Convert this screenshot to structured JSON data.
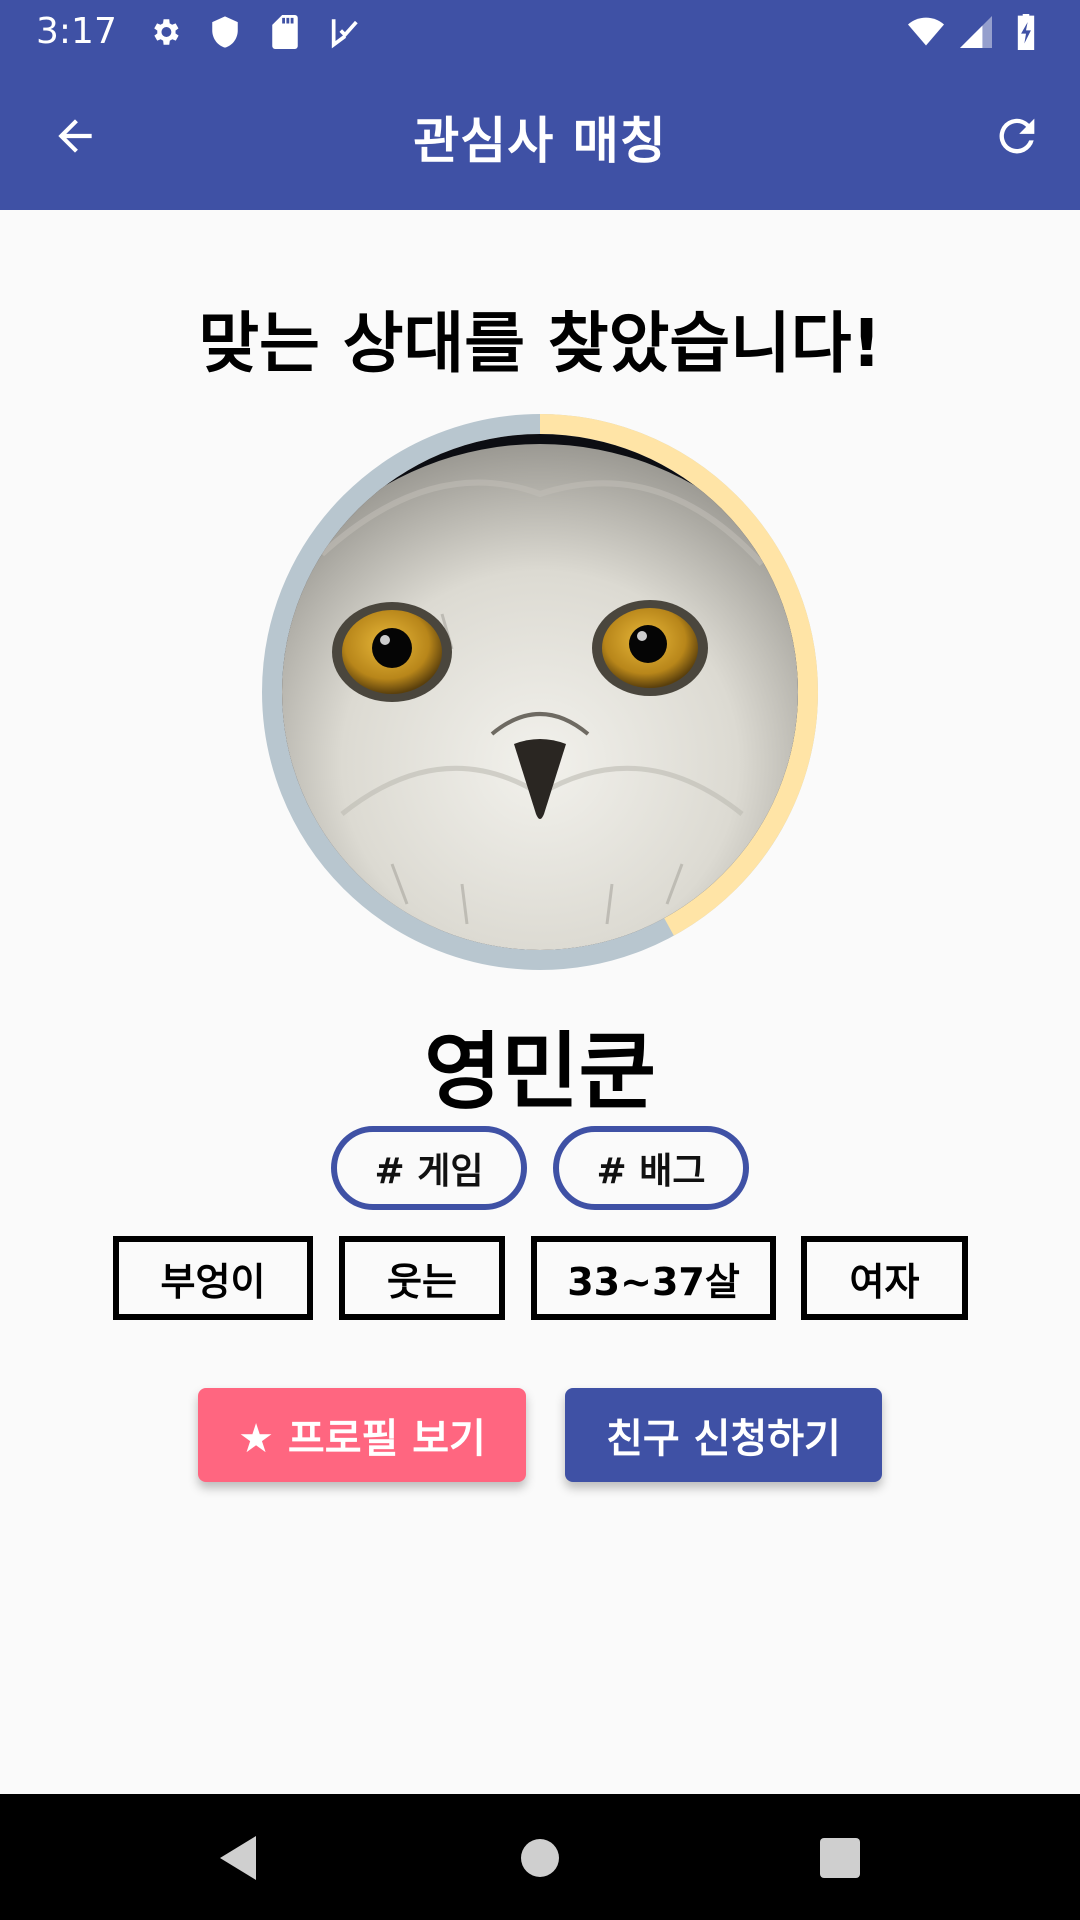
{
  "status_bar": {
    "time": "3:17",
    "icons_left": [
      "gear-icon",
      "shield-icon",
      "sd-card-icon",
      "inbox-check-icon"
    ],
    "icons_right": [
      "wifi-icon",
      "signal-icon",
      "battery-charging-icon"
    ]
  },
  "app_bar": {
    "title": "관심사 매칭",
    "back_icon": "arrow-back-icon",
    "refresh_icon": "refresh-icon",
    "color": "#3f51a5"
  },
  "main": {
    "heading": "맞는 상대를 찾았습니다!",
    "match_progress": 0.42,
    "ring_colors": {
      "progress": "#ffe4a6",
      "track": "#b8c6cf"
    },
    "name": "영민쿤",
    "tags": [
      "# 게임",
      "# 배그"
    ],
    "attributes": [
      "부엉이",
      "웃는",
      "33~37살",
      "여자"
    ],
    "buttons": {
      "profile_label": "★ 프로필 보기",
      "friend_label": "친구 신청하기"
    },
    "button_colors": {
      "profile": "#ff6680",
      "friend": "#3f51a5"
    }
  },
  "nav_bar": {
    "icons": [
      "nav-back-icon",
      "nav-home-icon",
      "nav-recents-icon"
    ]
  }
}
